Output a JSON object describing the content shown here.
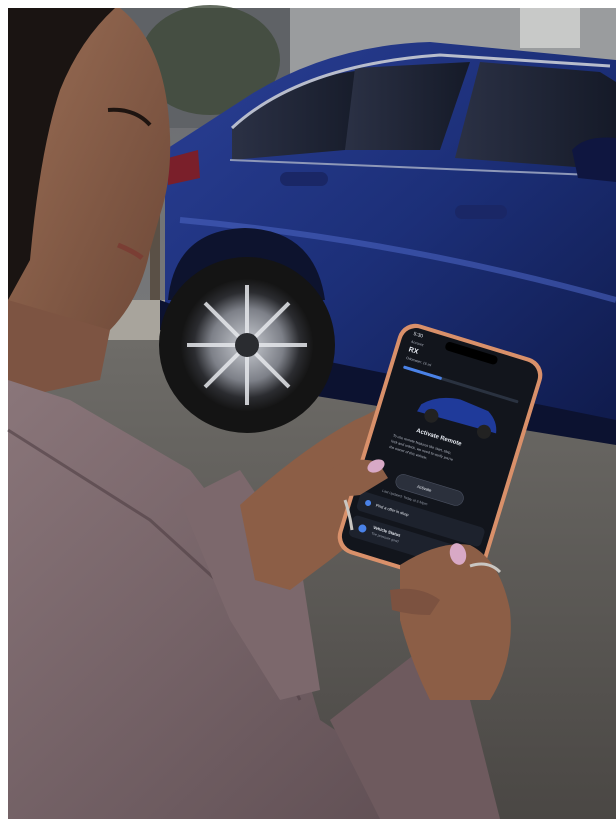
{
  "photo": {
    "subject": "woman-holding-phone",
    "background_object": "blue-suv"
  },
  "phone": {
    "status_time": "5:30",
    "account_label": "Account",
    "vehicle_name": "RX",
    "vehicle_sub": "Odometer: 16 mi",
    "card_title": "Activate Remote",
    "card_body_1": "To use remote features like start, stop,",
    "card_body_2": "lock and unlock, we need to verify you're",
    "card_body_3": "the owner of this vehicle.",
    "activate_label": "Activate",
    "last_updated": "Last Updated: Today at 3:34pm",
    "schedule_label": "Find a offer in shop",
    "status_title": "Vehicle Status",
    "status_sub": "Tire pressure good"
  },
  "colors": {
    "car_blue": "#1c2f78",
    "phone_frame": "#d9906a",
    "screen_bg": "#12151c",
    "nail_polish": "#d8a9c6"
  }
}
